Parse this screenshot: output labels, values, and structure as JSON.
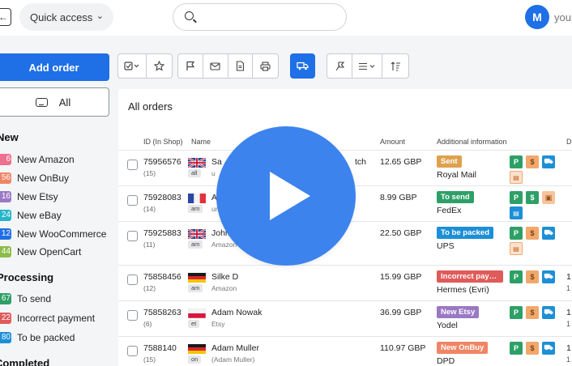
{
  "topbar": {
    "back_icon": "arrow-left-icon",
    "quick_access": "Quick access",
    "search_placeholder": "",
    "avatar_initial": "M",
    "user_name": "your"
  },
  "toolbar": {
    "add_order": "Add order"
  },
  "sidebar": {
    "all_label": "All",
    "sections": [
      {
        "title": "New",
        "items": [
          {
            "count": "6",
            "label": "New Amazon",
            "color": "#ee6f8e"
          },
          {
            "count": "56",
            "label": "New OnBuy",
            "color": "#f08565"
          },
          {
            "count": "16",
            "label": "New Etsy",
            "color": "#9a79c4"
          },
          {
            "count": "24",
            "label": "New eBay",
            "color": "#27b5c9"
          },
          {
            "count": "12",
            "label": "New WooCommerce",
            "color": "#1f6fe6"
          },
          {
            "count": "44",
            "label": "New OpenCart",
            "color": "#8cbd4a"
          }
        ]
      },
      {
        "title": "Processing",
        "items": [
          {
            "count": "67",
            "label": "To send",
            "color": "#2ea067"
          },
          {
            "count": "22",
            "label": "Incorrect payment",
            "color": "#e05a5a"
          },
          {
            "count": "80",
            "label": "To be packed",
            "color": "#1d8fd6"
          }
        ]
      },
      {
        "title": "Completed",
        "items": []
      }
    ]
  },
  "orders": {
    "title": "All orders",
    "headers": {
      "id": "ID (In Shop)",
      "name": "Name",
      "amount": "Amount",
      "info": "Additional information",
      "last": "D"
    },
    "rows": [
      {
        "id": "75956576",
        "sub": "(15)",
        "flag": "uk",
        "tag": "all",
        "name": "Sa",
        "name_sub": "u",
        "product": "tch",
        "amount": "12.65 GBP",
        "status": "Sent",
        "status_color": "#dea14e",
        "carrier": "Royal Mail",
        "icons": [
          "P",
          "$",
          "truck",
          "doc"
        ],
        "edge_a": "",
        "edge_b": ""
      },
      {
        "id": "75928083",
        "sub": "(14)",
        "flag": "fr",
        "tag": "am",
        "name": "A",
        "name_sub": "unr",
        "product": "",
        "amount": "8.99 GBP",
        "status": "To send",
        "status_color": "#2ea067",
        "carrier": "FedEx",
        "icons": [
          "P",
          "$",
          "gift",
          "docblue"
        ],
        "edge_a": "",
        "edge_b": ""
      },
      {
        "id": "75925883",
        "sub": "(11)",
        "flag": "uk",
        "tag": "am",
        "name": "John Smi",
        "name_sub": "Amazon",
        "product": "",
        "amount": "22.50 GBP",
        "status": "To be packed",
        "status_color": "#1d8fd6",
        "carrier": "UPS",
        "icons": [
          "P",
          "$",
          "truck",
          "doc"
        ],
        "edge_a": "",
        "edge_b": ""
      },
      {
        "id": "75858456",
        "sub": "(12)",
        "flag": "de",
        "tag": "am",
        "name": "Silke D",
        "name_sub": "Amazon",
        "product": "",
        "amount": "15.99 GBP",
        "status": "Incorrect payment",
        "status_color": "#e05a5a",
        "carrier": "Hermes (Evri)",
        "icons": [
          "P",
          "$",
          "truck"
        ],
        "edge_a": "1",
        "edge_b": "1"
      },
      {
        "id": "75858263",
        "sub": "(6)",
        "flag": "pl",
        "tag": "et",
        "name": "Adam Nowak",
        "name_sub": "Etsy",
        "product": "",
        "amount": "36.99 GBP",
        "status": "New Etsy",
        "status_color": "#9a79c4",
        "carrier": "Yodel",
        "icons": [
          "P",
          "$",
          "truck"
        ],
        "edge_a": "1",
        "edge_b": "1"
      },
      {
        "id": "7588140",
        "sub": "(15)",
        "flag": "de",
        "tag": "on",
        "name": "Adam Muller",
        "name_sub": "(Adam Muller)",
        "product": "",
        "amount": "110.97 GBP",
        "status": "New OnBuy",
        "status_color": "#f08565",
        "carrier": "DPD",
        "icons": [
          "P",
          "$",
          "truck"
        ],
        "edge_a": "1",
        "edge_b": "1"
      }
    ]
  },
  "overlay": {
    "icon": "play-icon"
  }
}
